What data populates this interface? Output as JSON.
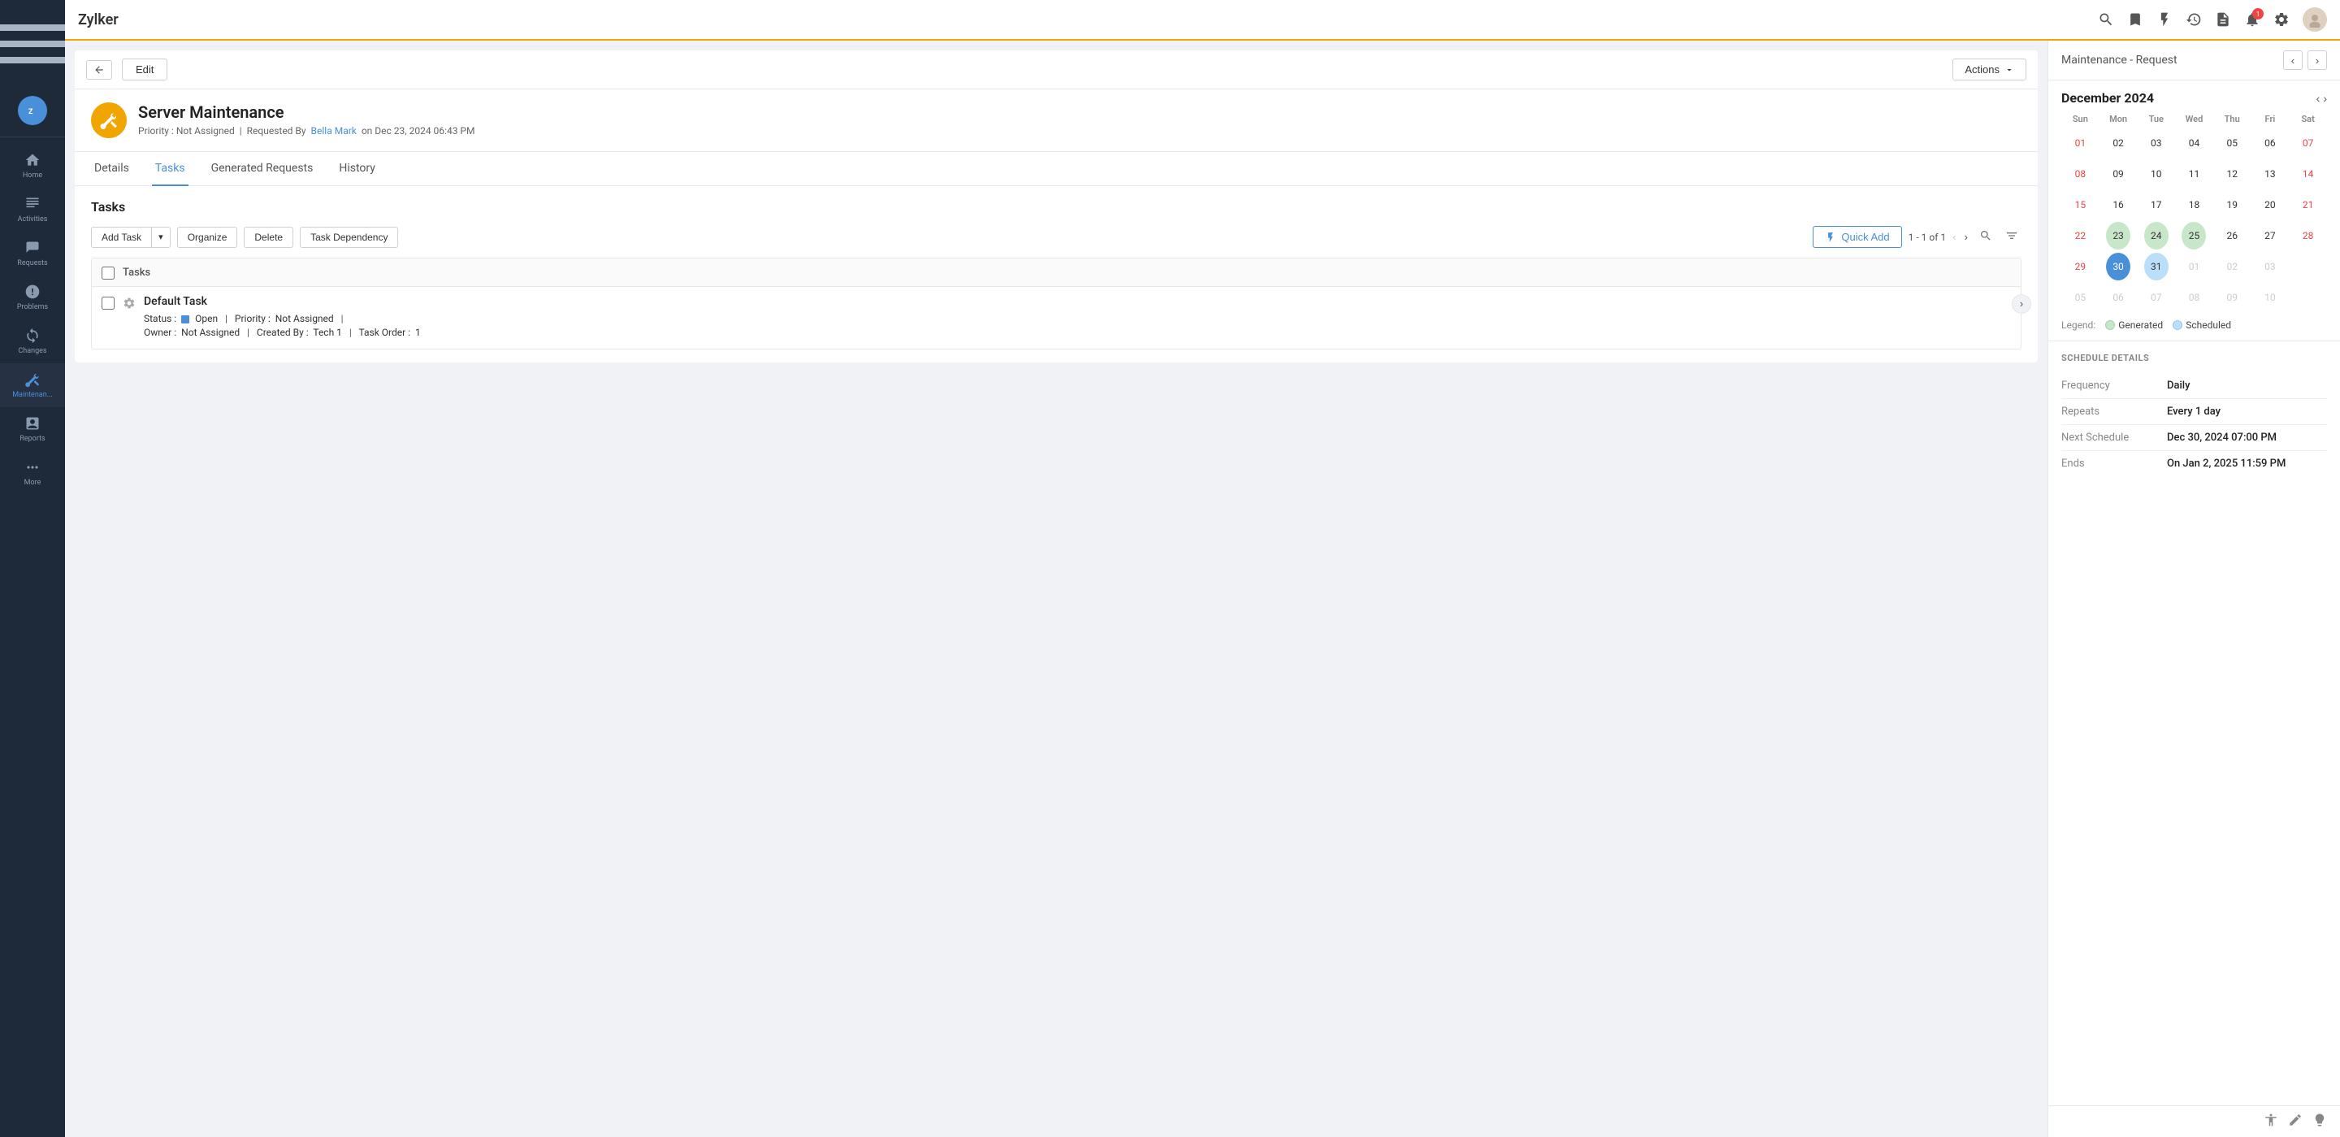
{
  "app": {
    "name": "Zylker",
    "logo_text": "Z"
  },
  "sidebar": {
    "items": [
      {
        "id": "home",
        "label": "Home",
        "active": false
      },
      {
        "id": "activities",
        "label": "Activities",
        "active": false
      },
      {
        "id": "requests",
        "label": "Requests",
        "active": false
      },
      {
        "id": "problems",
        "label": "Problems",
        "active": false
      },
      {
        "id": "changes",
        "label": "Changes",
        "active": false
      },
      {
        "id": "maintenance",
        "label": "Maintenan...",
        "active": true
      },
      {
        "id": "reports",
        "label": "Reports",
        "active": false
      },
      {
        "id": "more",
        "label": "More",
        "active": false
      }
    ]
  },
  "topbar": {
    "notification_count": "1"
  },
  "card_header": {
    "edit_label": "Edit",
    "actions_label": "Actions"
  },
  "request": {
    "title": "Server Maintenance",
    "priority_label": "Priority :",
    "priority_value": "Not Assigned",
    "requested_by_label": "Requested By",
    "requested_by_name": "Bella Mark",
    "date": "on Dec 23, 2024 06:43 PM"
  },
  "tabs": [
    {
      "id": "details",
      "label": "Details"
    },
    {
      "id": "tasks",
      "label": "Tasks",
      "active": true
    },
    {
      "id": "generated",
      "label": "Generated Requests"
    },
    {
      "id": "history",
      "label": "History"
    }
  ],
  "tasks_section": {
    "title": "Tasks",
    "add_task_label": "Add Task",
    "organize_label": "Organize",
    "delete_label": "Delete",
    "task_dependency_label": "Task Dependency",
    "quick_add_label": "Quick Add",
    "pagination": "1 - 1 of 1",
    "column_header": "Tasks"
  },
  "task": {
    "name": "Default Task",
    "status_label": "Status :",
    "status_value": "Open",
    "priority_label": "Priority :",
    "priority_value": "Not Assigned",
    "owner_label": "Owner :",
    "owner_value": "Not Assigned",
    "created_by_label": "Created By :",
    "created_by_value": "Tech 1",
    "task_order_label": "Task Order :",
    "task_order_value": "1"
  },
  "right_panel": {
    "title": "Maintenance - Request"
  },
  "calendar": {
    "month_year": "December 2024",
    "day_headers": [
      "Sun",
      "Mon",
      "Tue",
      "Wed",
      "Thu",
      "Fri",
      "Sat"
    ],
    "weeks": [
      [
        {
          "day": "01",
          "type": "weekend"
        },
        {
          "day": "02",
          "type": "normal"
        },
        {
          "day": "03",
          "type": "normal"
        },
        {
          "day": "04",
          "type": "normal"
        },
        {
          "day": "05",
          "type": "normal"
        },
        {
          "day": "06",
          "type": "normal"
        },
        {
          "day": "07",
          "type": "weekend"
        }
      ],
      [
        {
          "day": "08",
          "type": "weekend"
        },
        {
          "day": "09",
          "type": "normal"
        },
        {
          "day": "10",
          "type": "normal"
        },
        {
          "day": "11",
          "type": "normal"
        },
        {
          "day": "12",
          "type": "normal"
        },
        {
          "day": "13",
          "type": "normal"
        },
        {
          "day": "14",
          "type": "weekend"
        }
      ],
      [
        {
          "day": "15",
          "type": "weekend"
        },
        {
          "day": "16",
          "type": "normal"
        },
        {
          "day": "17",
          "type": "normal"
        },
        {
          "day": "18",
          "type": "normal"
        },
        {
          "day": "19",
          "type": "normal"
        },
        {
          "day": "20",
          "type": "normal"
        },
        {
          "day": "21",
          "type": "weekend"
        }
      ],
      [
        {
          "day": "22",
          "type": "weekend"
        },
        {
          "day": "23",
          "type": "generated"
        },
        {
          "day": "24",
          "type": "generated"
        },
        {
          "day": "25",
          "type": "generated"
        },
        {
          "day": "26",
          "type": "normal"
        },
        {
          "day": "27",
          "type": "normal"
        },
        {
          "day": "28",
          "type": "weekend"
        }
      ],
      [
        {
          "day": "29",
          "type": "weekend"
        },
        {
          "day": "30",
          "type": "today"
        },
        {
          "day": "31",
          "type": "scheduled"
        },
        {
          "day": "01",
          "type": "other-month"
        },
        {
          "day": "02",
          "type": "other-month"
        },
        {
          "day": "03",
          "type": "other-month"
        },
        {
          "day": "",
          "type": "other-month"
        }
      ],
      [
        {
          "day": "05",
          "type": "other-month"
        },
        {
          "day": "06",
          "type": "other-month"
        },
        {
          "day": "07",
          "type": "other-month"
        },
        {
          "day": "08",
          "type": "other-month"
        },
        {
          "day": "09",
          "type": "other-month"
        },
        {
          "day": "10",
          "type": "other-month"
        },
        {
          "day": "",
          "type": "other-month"
        }
      ]
    ],
    "legend": {
      "generated_label": "Generated",
      "scheduled_label": "Scheduled"
    }
  },
  "schedule": {
    "section_title": "SCHEDULE DETAILS",
    "frequency_label": "Frequency",
    "frequency_value": "Daily",
    "repeats_label": "Repeats",
    "repeats_value": "Every 1 day",
    "next_schedule_label": "Next Schedule",
    "next_schedule_value": "Dec 30, 2024 07:00 PM",
    "ends_label": "Ends",
    "ends_value": "On Jan 2, 2025 11:59 PM"
  }
}
